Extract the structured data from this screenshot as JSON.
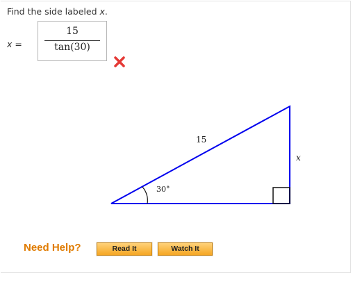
{
  "question": {
    "prompt_prefix": "Find the side labeled",
    "prompt_var": "x",
    "prompt_suffix": "."
  },
  "answer": {
    "label_var": "x",
    "label_eq": " =",
    "numerator": "15",
    "denominator": "tan(30)",
    "status": "incorrect",
    "status_icon": "x-mark-icon",
    "status_color": "#e53935"
  },
  "figure": {
    "hypotenuse_label": "15",
    "angle_label": "30°",
    "side_label": "x",
    "line_color": "#0000ee"
  },
  "help": {
    "label": "Need Help?",
    "read_it": "Read It",
    "watch_it": "Watch It"
  }
}
